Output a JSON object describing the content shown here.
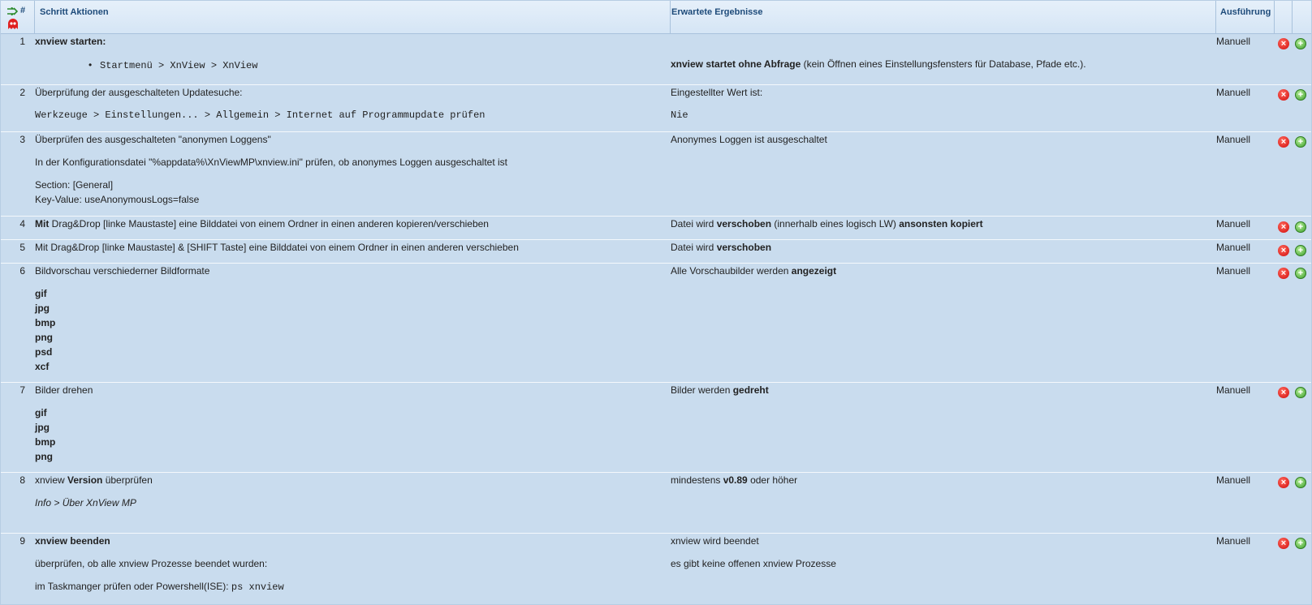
{
  "header": {
    "num_label": "#",
    "actions_label": "Schritt Aktionen",
    "expected_label": "Erwartete Ergebnisse",
    "execution_label": "Ausführung"
  },
  "rows": [
    {
      "num": "1",
      "mode": "Manuell",
      "a1": "xnview starten:",
      "a2": "Startmenü > XnView > XnView",
      "e1": "xnview startet ohne Abfrage",
      "e2": " (kein Öffnen eines Einstellungsfensters für Database, Pfade etc.)."
    },
    {
      "num": "2",
      "mode": "Manuell",
      "a1": "Überprüfung der ausgeschalteten Updatesuche:",
      "a2": "Werkzeuge > Einstellungen... > Allgemein > Internet auf Programmupdate prüfen",
      "e1": "Eingestellter Wert ist:",
      "e2": "Nie"
    },
    {
      "num": "3",
      "mode": "Manuell",
      "a1": "Überprüfen des ausgeschalteten \"anonymen Loggens\"",
      "a2": "In der Konfigurationsdatei \"%appdata%\\XnViewMP\\xnview.ini\" prüfen, ob anonymes Loggen ausgeschaltet ist",
      "a3": "Section: [General]",
      "a4": "Key-Value: useAnonymousLogs=false",
      "e1": "Anonymes Loggen ist ausgeschaltet"
    },
    {
      "num": "4",
      "mode": "Manuell",
      "a1b": "Mit",
      "a1": " Drag&Drop [linke Maustaste] eine Bilddatei von einem Ordner in einen anderen kopieren/verschieben",
      "e1": "Datei wird ",
      "e2": "verschoben",
      "e3": " (innerhalb eines logisch LW) ",
      "e4": "ansonsten kopiert"
    },
    {
      "num": "5",
      "mode": "Manuell",
      "a1": "Mit Drag&Drop [linke Maustaste] & [SHIFT Taste] eine Bilddatei von einem Ordner in einen anderen verschieben",
      "e1": "Datei wird ",
      "e2": "verschoben"
    },
    {
      "num": "6",
      "mode": "Manuell",
      "a1": "Bildvorschau verschiederner Bildformate",
      "formats": [
        "gif",
        "jpg",
        "bmp",
        "png",
        "psd",
        "xcf"
      ],
      "e1": "Alle Vorschaubilder werden ",
      "e2": "angezeigt"
    },
    {
      "num": "7",
      "mode": "Manuell",
      "a1": "Bilder drehen",
      "formats": [
        "gif",
        "jpg",
        "bmp",
        "png"
      ],
      "e1": "Bilder werden ",
      "e2": "gedreht"
    },
    {
      "num": "8",
      "mode": "Manuell",
      "a1": "xnview ",
      "a1b": "Version",
      "a1c": " überprüfen",
      "a2": "Info > Über XnView MP",
      "e1": "mindestens ",
      "e2": "v0.89",
      "e3": " oder höher"
    },
    {
      "num": "9",
      "mode": "Manuell",
      "a1": "xnview beenden",
      "a2": "überprüfen, ob alle xnview Prozesse beendet wurden:",
      "a3": "im Taskmanger prüfen oder Powershell(ISE): ",
      "a3code": "ps xnview",
      "e1": "xnview wird beendet",
      "e2": "es gibt keine offenen xnview Prozesse"
    }
  ]
}
